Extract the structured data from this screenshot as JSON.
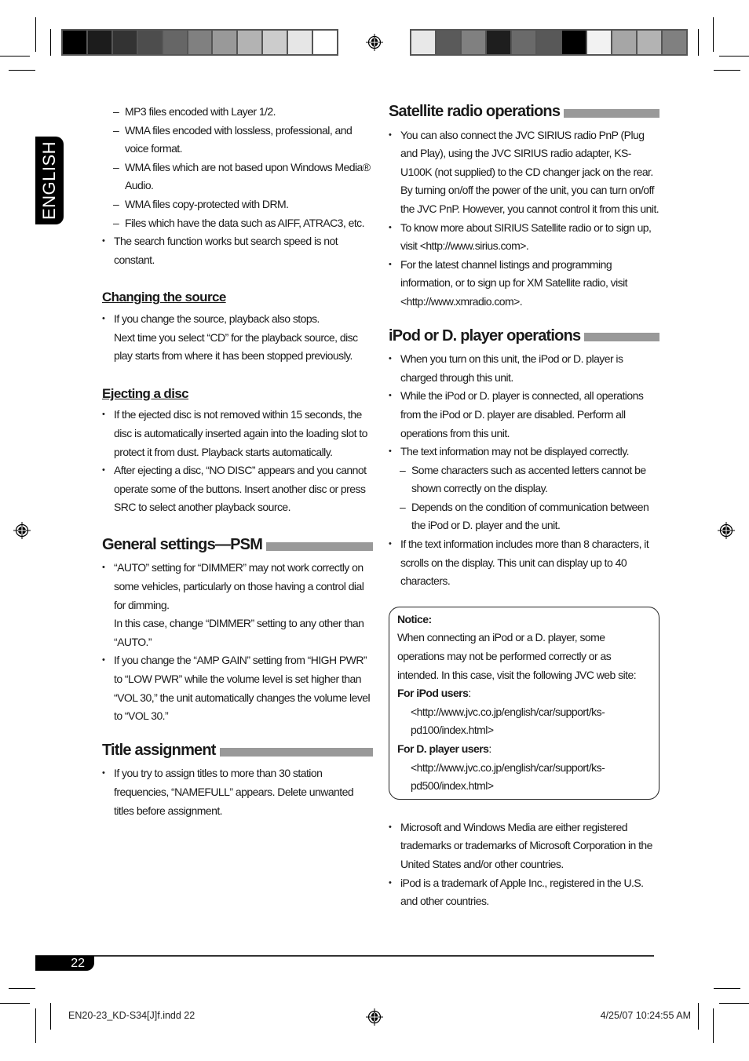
{
  "color_bar_left": [
    "#000000",
    "#1c1c1c",
    "#333333",
    "#4d4d4d",
    "#666666",
    "#808080",
    "#999999",
    "#b3b3b3",
    "#cccccc",
    "#e6e6e6",
    "#ffffff"
  ],
  "color_bar_right": [
    "#e8e8e8",
    "#5a5a5a",
    "#808080",
    "#1e1e1e",
    "#6a6a6a",
    "#585858",
    "#000000",
    "#f2f2f2",
    "#a6a6a6",
    "#b3b3b3",
    "#808080"
  ],
  "language_tab": "ENGLISH",
  "left": {
    "intro_dashes": [
      "MP3 files encoded with Layer 1/2.",
      "WMA files encoded with lossless, professional, and voice format.",
      "WMA files which are not based upon Windows Media® Audio.",
      "WMA files copy-protected with DRM.",
      "Files which have the data such as AIFF, ATRAC3, etc."
    ],
    "intro_bullet": "The search function works but search speed is not constant.",
    "changing_source": {
      "heading": "Changing the source",
      "bullets": [
        "If you change the source, playback also stops.\nNext time you select “CD” for the playback source, disc play starts from where it has been stopped previously."
      ]
    },
    "ejecting": {
      "heading": "Ejecting a disc",
      "bullets": [
        "If the ejected disc is not removed within 15 seconds, the disc is automatically inserted again into the loading slot to protect it from dust. Playback starts automatically.",
        "After ejecting a disc, “NO DISC” appears and you cannot operate some of the buttons. Insert another disc or press SRC to select another playback source."
      ]
    },
    "general": {
      "heading": "General settings—PSM",
      "bullets": [
        "“AUTO” setting for “DIMMER” may not work correctly on some vehicles, particularly on those having a control dial for dimming.\nIn this case, change “DIMMER” setting to any other than “AUTO.”",
        "If you change the “AMP GAIN” setting from “HIGH PWR” to “LOW PWR” while the volume level is set higher than “VOL 30,” the unit automatically changes the volume level to “VOL 30.”"
      ]
    },
    "title_assignment": {
      "heading": "Title assignment",
      "bullets": [
        "If you try to assign titles to more than 30 station frequencies, “NAMEFULL” appears. Delete unwanted titles before assignment."
      ]
    }
  },
  "right": {
    "satellite": {
      "heading": "Satellite radio operations",
      "bullets": [
        "You can also connect the JVC SIRIUS radio PnP (Plug and Play), using the JVC SIRIUS radio adapter, KS-U100K (not supplied) to the CD changer jack on the rear.\nBy turning on/off the power of the unit, you can turn on/off the JVC PnP. However, you cannot control it from this unit.",
        "To know more about SIRIUS Satellite radio or to sign up, visit <http://www.sirius.com>.",
        "For the latest channel listings and programming information, or to sign up for XM Satellite radio, visit <http://www.xmradio.com>."
      ]
    },
    "ipod": {
      "heading": "iPod or D. player operations",
      "bullets": [
        "When you turn on this unit, the iPod or D. player is charged through this unit.",
        "While the iPod or D. player is connected, all operations from the iPod or D. player are disabled. Perform all operations from this unit.",
        "The text information may not be displayed correctly."
      ],
      "sub_dashes": [
        "Some characters such as accented letters cannot be shown correctly on the display.",
        "Depends on the condition of communication between the iPod or D. player and the unit."
      ],
      "last_bullet": "If the text information includes more than 8 characters, it scrolls on the display. This unit can display up to 40 characters."
    },
    "notice": {
      "title": "Notice:",
      "body": "When connecting an iPod or a D. player, some operations may not be performed correctly or as intended. In this case, visit the following JVC web site:",
      "ipod_label": "For iPod users",
      "ipod_url": ": <http://www.jvc.co.jp/english/car/support/ks-pd100/index.html>",
      "dplayer_label": "For D. player users",
      "dplayer_url": ": <http://www.jvc.co.jp/english/car/support/ks-pd500/index.html>"
    },
    "trademarks": [
      "Microsoft and Windows Media are either registered trademarks or trademarks of Microsoft Corporation in the United States and/or other countries.",
      "iPod is a trademark of Apple Inc., registered in the U.S. and other countries."
    ]
  },
  "page_number": "22",
  "slug_left": "EN20-23_KD-S34[J]f.indd   22",
  "slug_right": "4/25/07   10:24:55 AM"
}
